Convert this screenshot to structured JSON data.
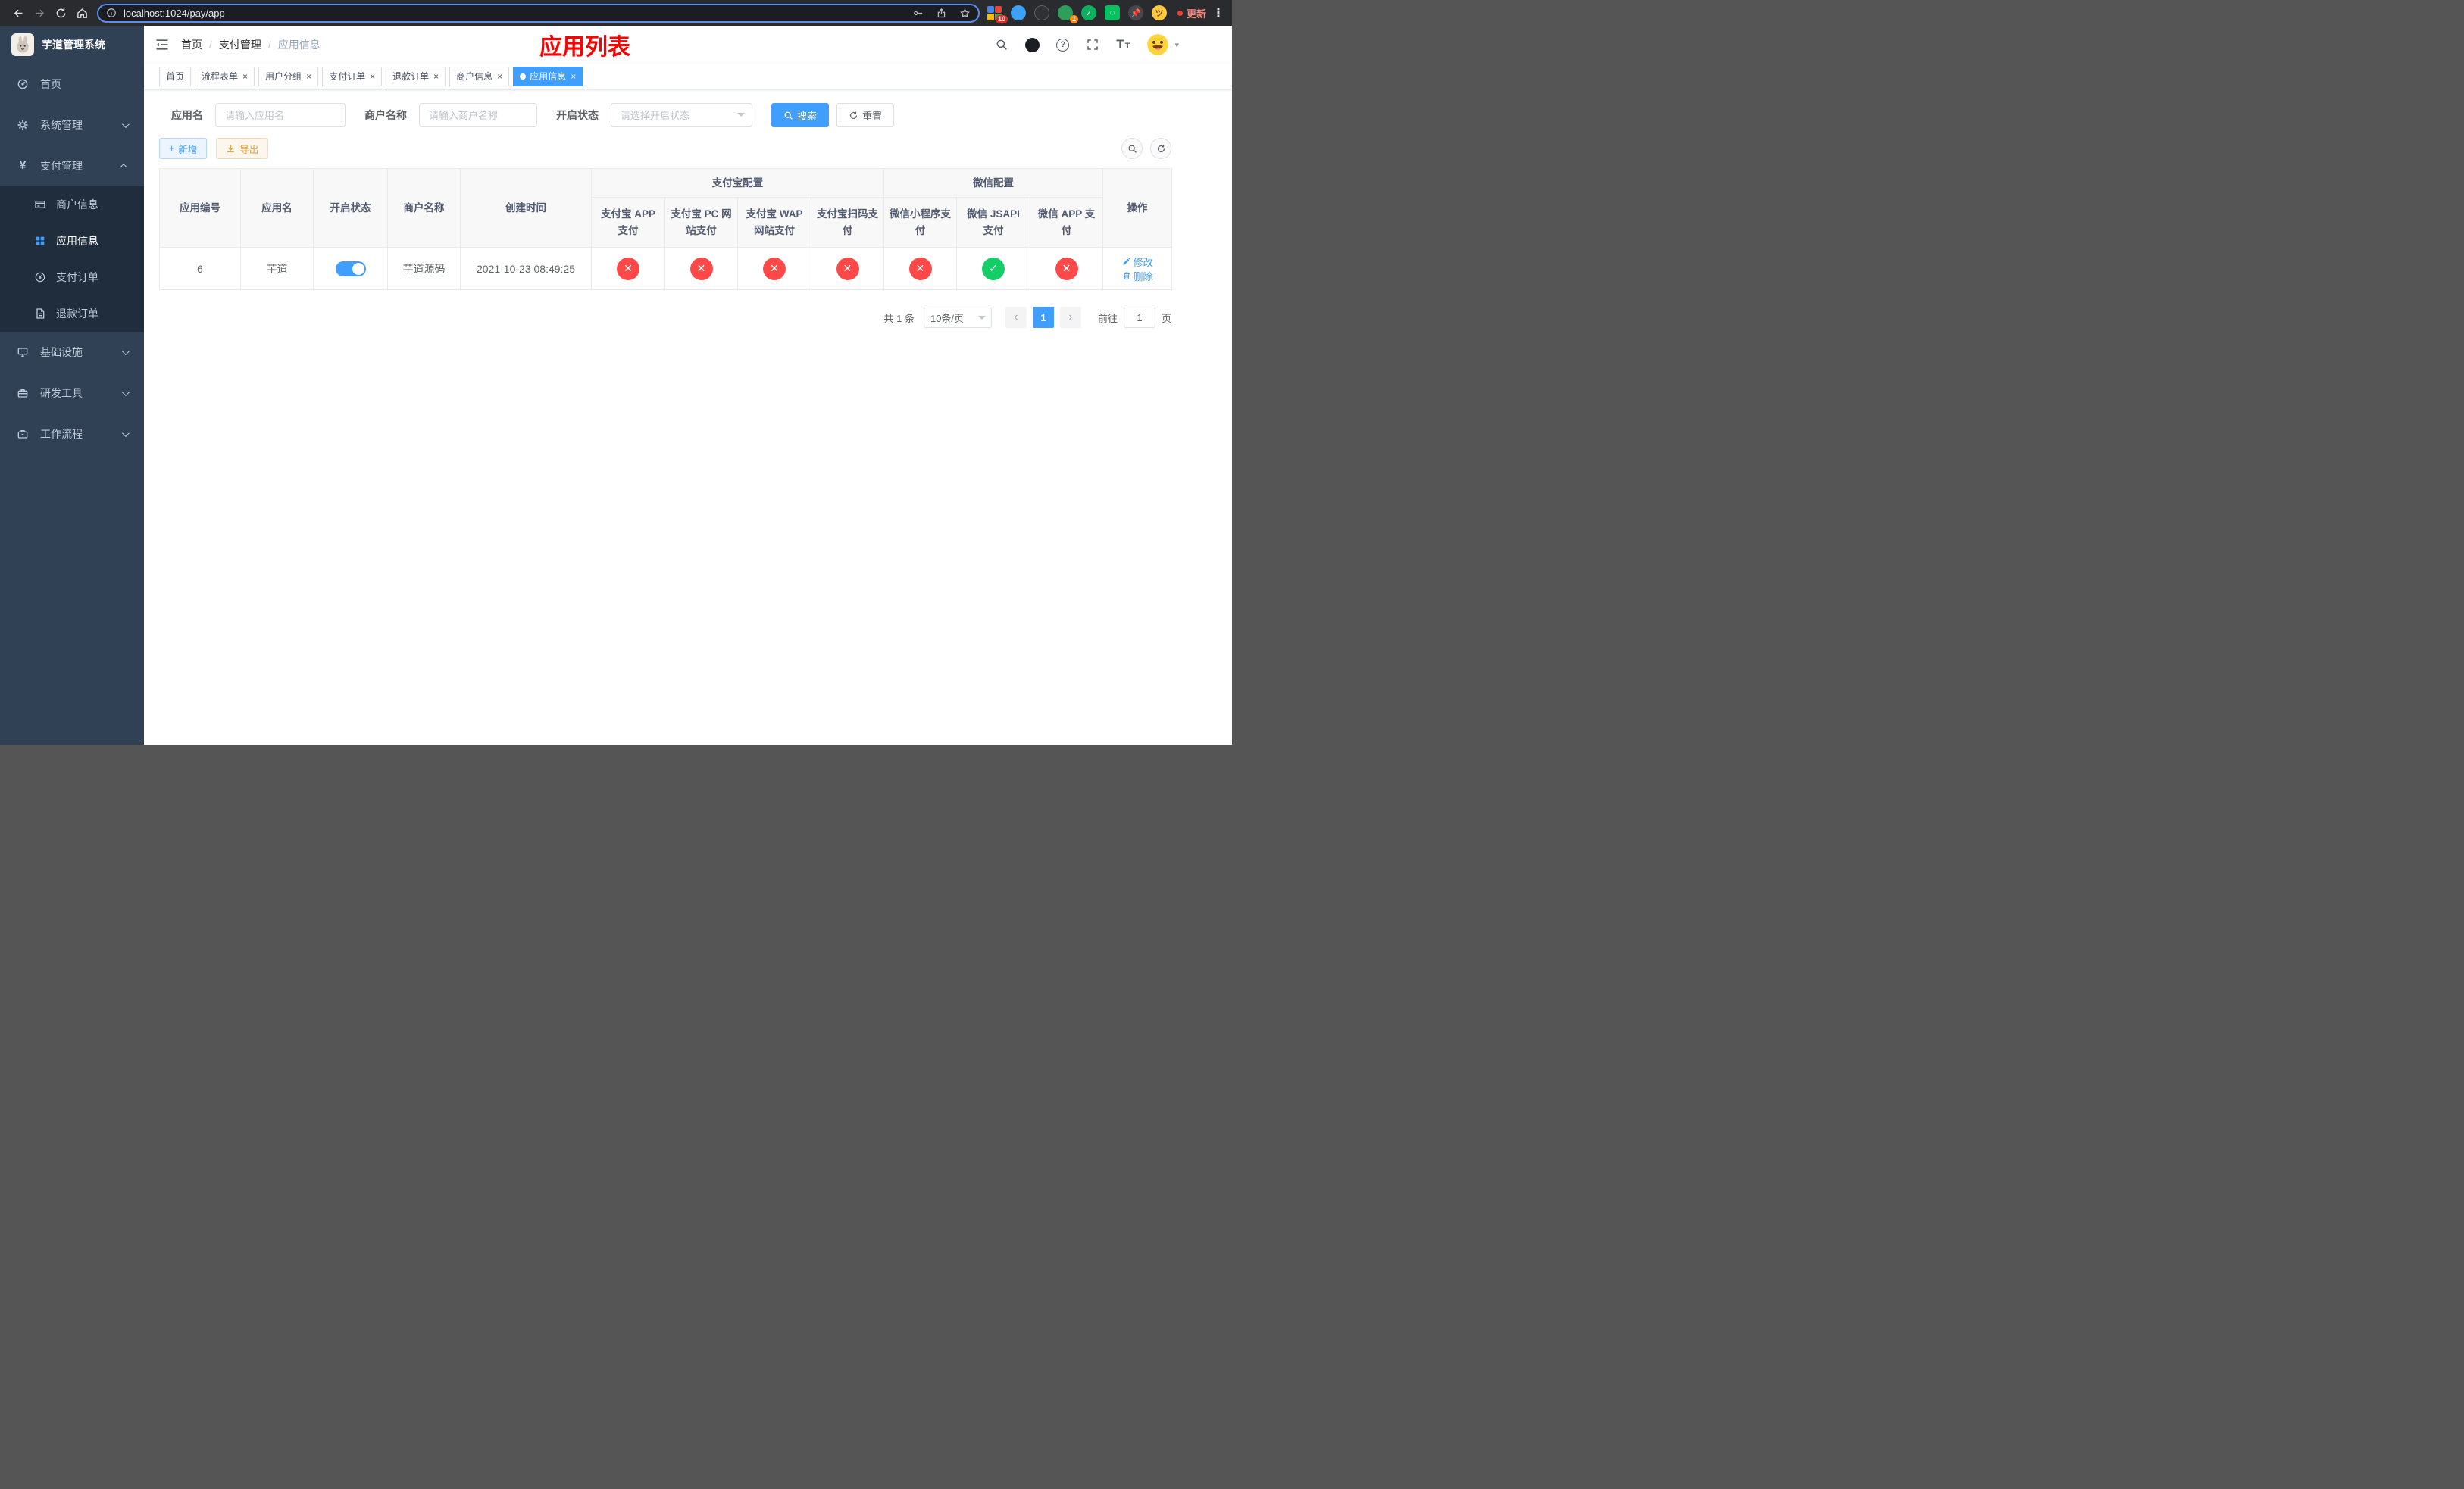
{
  "browser": {
    "url": "localhost:1024/pay/app",
    "update_label": "更新",
    "ext_badge_puzzle": "10",
    "ext_badge_profile": "1"
  },
  "icons": {
    "check": "✓",
    "cross": "✕",
    "close": "×",
    "caret": "▾",
    "prev": "‹",
    "next": "›",
    "plus": "+",
    "yen": "¥",
    "question": "?",
    "font_large": "T",
    "font_small": "T",
    "kebab": "⋮"
  },
  "colors": {
    "primary": "#409eff",
    "danger": "#ff4949",
    "success": "#13ce66",
    "warning": "#e6a23c",
    "page_title": "#ff0000",
    "sidebar_bg": "#304156",
    "submenu_bg": "#1f2d3d"
  },
  "sidebar": {
    "logo_title": "芋道管理系统",
    "items": [
      {
        "label": "首页"
      },
      {
        "label": "系统管理"
      },
      {
        "label": "支付管理"
      },
      {
        "label": "商户信息"
      },
      {
        "label": "应用信息"
      },
      {
        "label": "支付订单"
      },
      {
        "label": "退款订单"
      },
      {
        "label": "基础设施"
      },
      {
        "label": "研发工具"
      },
      {
        "label": "工作流程"
      }
    ]
  },
  "header": {
    "breadcrumb": [
      "首页",
      "支付管理",
      "应用信息"
    ],
    "page_title": "应用列表"
  },
  "tabs": [
    {
      "label": "首页"
    },
    {
      "label": "流程表单"
    },
    {
      "label": "用户分组"
    },
    {
      "label": "支付订单"
    },
    {
      "label": "退款订单"
    },
    {
      "label": "商户信息"
    },
    {
      "label": "应用信息"
    }
  ],
  "filters": {
    "app_name_label": "应用名",
    "app_name_placeholder": "请输入应用名",
    "merchant_label": "商户名称",
    "merchant_placeholder": "请输入商户名称",
    "status_label": "开启状态",
    "status_placeholder": "请选择开启状态",
    "search_button": "搜索",
    "reset_button": "重置"
  },
  "toolbar": {
    "add_button": "新增",
    "export_button": "导出"
  },
  "table": {
    "columns": [
      "应用编号",
      "应用名",
      "开启状态",
      "商户名称",
      "创建时间"
    ],
    "alipay_group": "支付宝配置",
    "wechat_group": "微信配置",
    "sub_columns": [
      "支付宝 APP 支付",
      "支付宝 PC 网站支付",
      "支付宝 WAP 网站支付",
      "支付宝扫码支付",
      "微信小程序支付",
      "微信 JSAPI 支付",
      "微信 APP 支付"
    ],
    "op_column": "操作",
    "rows": [
      {
        "id": "6",
        "name": "芋道",
        "enabled": true,
        "merchant": "芋道源码",
        "created": "2021-10-23 08:49:25",
        "statuses": [
          false,
          false,
          false,
          false,
          false,
          true,
          false
        ],
        "edit_label": "修改",
        "delete_label": "删除"
      }
    ]
  },
  "pagination": {
    "total": "共 1 条",
    "page_size": "10条/页",
    "current_page": "1",
    "goto_label": "前往",
    "goto_value": "1",
    "goto_suffix": "页"
  }
}
